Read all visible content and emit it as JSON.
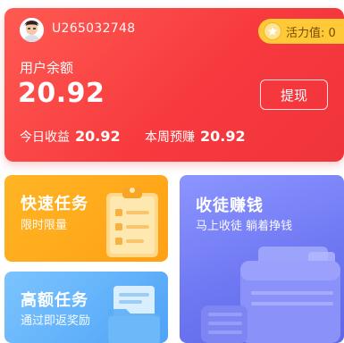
{
  "user": {
    "id": "U265032748"
  },
  "vitality": {
    "label": "活力值: 0"
  },
  "balance": {
    "label": "用户余额",
    "value": "20.92",
    "withdraw_label": "提现",
    "today_label": "今日收益",
    "today_value": "20.92",
    "week_label": "本周预赚",
    "week_value": "20.92"
  },
  "tasks": {
    "fast": {
      "title": "快速任务",
      "subtitle": "限时限量"
    },
    "high": {
      "title": "高额任务",
      "subtitle": "通过即返奖励"
    },
    "recruit": {
      "title": "收徒赚钱",
      "subtitle": "马上收徒 躺着挣钱"
    }
  },
  "colors": {
    "balance_card": "#f73a3e",
    "vitality_badge": "#ffc937",
    "fast_card": "#ffa014",
    "high_card": "#4ea3f6",
    "recruit_card": "#6f78f2"
  },
  "icons": [
    "avatar",
    "star-icon",
    "clipboard-icon",
    "folder-icon",
    "wallet-icon"
  ]
}
